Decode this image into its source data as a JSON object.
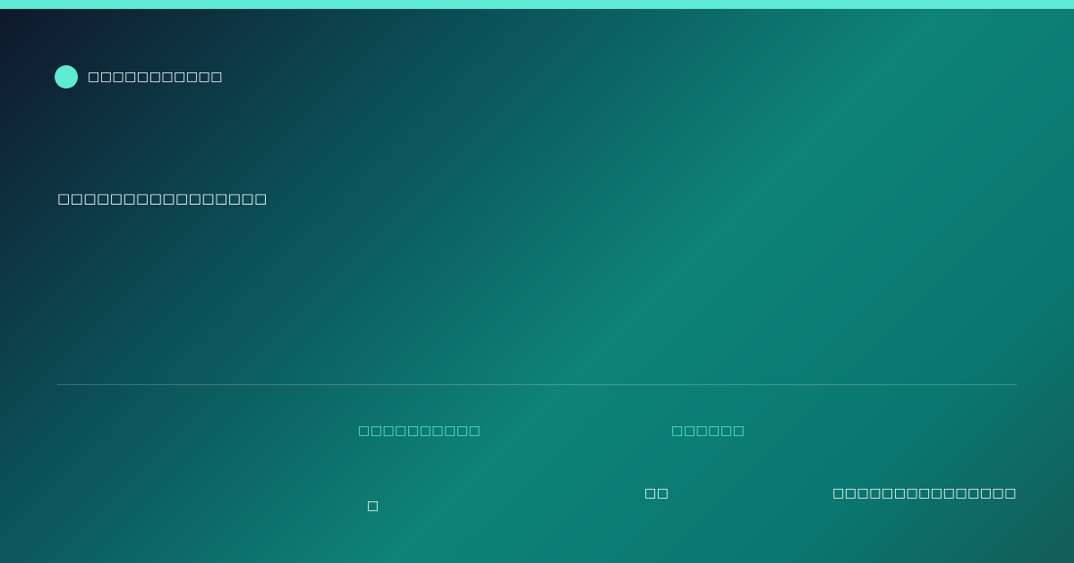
{
  "brand": {
    "name": "□□□□□□□□□□□",
    "accent_color": "#5eead4"
  },
  "headline": "□□□□□□□□□□□□□□□□",
  "meta": {
    "label_1": "□□□□□□□□□□",
    "label_2": "□□□□□□",
    "value_1": "□",
    "value_2": "□□",
    "value_3": "□□□□□□□□□□□□□□□"
  },
  "colors": {
    "accent": "#5eead4",
    "background_start": "#0f172a",
    "background_mid": "#0e8378",
    "text": "#ffffff"
  }
}
